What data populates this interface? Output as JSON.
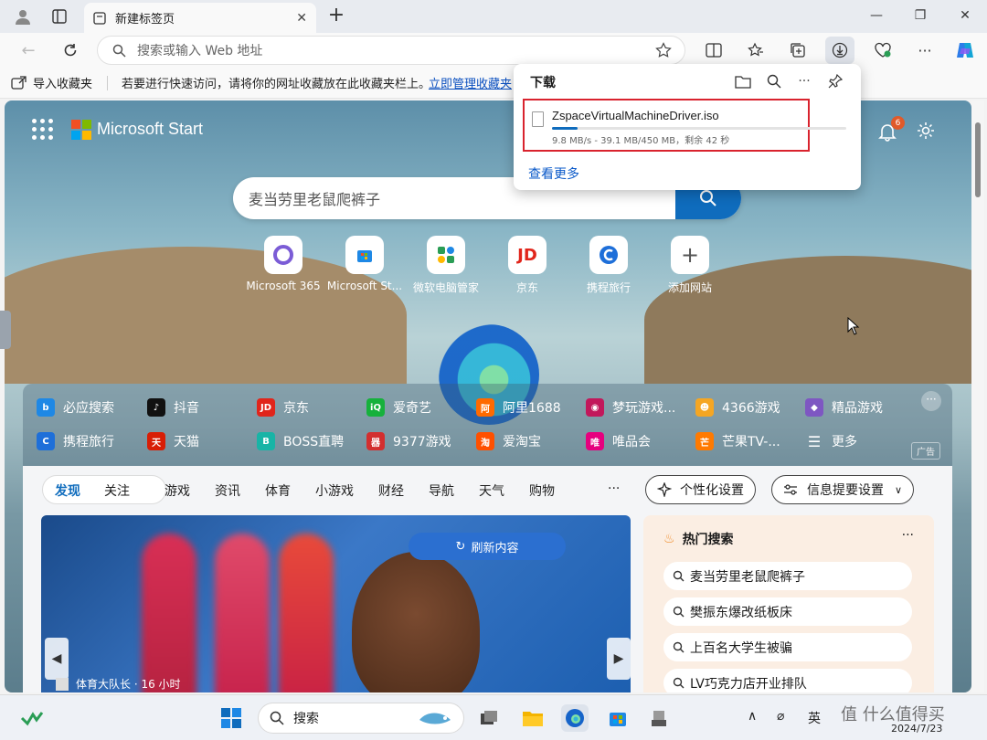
{
  "tab": {
    "title": "新建标签页",
    "close": "✕",
    "new_tab": "+"
  },
  "window": {
    "minimize": "—",
    "maximize": "❐",
    "close": "✕"
  },
  "address": {
    "placeholder": "搜索或输入 Web 地址"
  },
  "favorites_bar": {
    "import_label": "导入收藏夹",
    "message": "若要进行快速访问，请将你的网址收藏放在此收藏夹栏上。",
    "manage_link": "立即管理收藏夹"
  },
  "start": {
    "brand": "Microsoft Start",
    "notification_count": "6",
    "search_query": "麦当劳里老鼠爬裤子",
    "quick_links": [
      {
        "label": "Microsoft 365",
        "color": "#7b5cd6"
      },
      {
        "label": "Microsoft St...",
        "color": "#1e88e5"
      },
      {
        "label": "微软电脑管家",
        "color": "#2a9d55"
      },
      {
        "label": "京东",
        "color": "#e1251b"
      },
      {
        "label": "携程旅行",
        "color": "#1e6fd9"
      },
      {
        "label": "添加网站",
        "color": "#666666"
      }
    ],
    "link_panel": [
      {
        "label": "必应搜索",
        "color": "#1e88e5",
        "glyph": "b"
      },
      {
        "label": "抖音",
        "color": "#111111",
        "glyph": "♪"
      },
      {
        "label": "京东",
        "color": "#e1251b",
        "glyph": "JD"
      },
      {
        "label": "爱奇艺",
        "color": "#16b13c",
        "glyph": "iQ"
      },
      {
        "label": "阿里1688",
        "color": "#ff6a00",
        "glyph": "阿"
      },
      {
        "label": "梦玩游戏...",
        "color": "#c2185b",
        "glyph": "◉"
      },
      {
        "label": "4366游戏",
        "color": "#f5a623",
        "glyph": "☻"
      },
      {
        "label": "精品游戏",
        "color": "#7e57c2",
        "glyph": "◆"
      },
      {
        "label": "携程旅行",
        "color": "#1e6fd9",
        "glyph": "C"
      },
      {
        "label": "天猫",
        "color": "#d81e06",
        "glyph": "天"
      },
      {
        "label": "BOSS直聘",
        "color": "#18b4a6",
        "glyph": "B"
      },
      {
        "label": "9377游戏",
        "color": "#d32f2f",
        "glyph": "器"
      },
      {
        "label": "爱淘宝",
        "color": "#ff5000",
        "glyph": "淘"
      },
      {
        "label": "唯品会",
        "color": "#e6007e",
        "glyph": "唯"
      },
      {
        "label": "芒果TV-...",
        "color": "#ff7a00",
        "glyph": "芒"
      },
      {
        "label": "更多",
        "color": "transparent",
        "glyph": "☰"
      }
    ],
    "more_dots": "···",
    "ad_label": "广告"
  },
  "feed": {
    "tab_discover": "发现",
    "tab_follow": "关注",
    "categories": [
      "游戏",
      "资讯",
      "体育",
      "小游戏",
      "财经",
      "导航",
      "天气",
      "购物"
    ],
    "cat_more": "···",
    "personalize": "个性化设置",
    "info_settings": "信息提要设置",
    "refresh": "刷新内容",
    "hero_caption": "体育大队长 · 16 小时",
    "hot_title": "热门搜索",
    "hot_dots": "···",
    "hot_items": [
      "麦当劳里老鼠爬裤子",
      "樊振东爆改纸板床",
      "上百名大学生被骗",
      "LV巧克力店开业排队"
    ]
  },
  "downloads": {
    "title": "下载",
    "file_name": "ZspaceVirtualMachineDriver.iso",
    "status": "9.8 MB/s - 39.1 MB/450 MB，剩余 42 秒",
    "progress": 0.087,
    "see_more": "查看更多"
  },
  "taskbar": {
    "search_label": "搜索",
    "ime": "英",
    "date": "2024/7/23"
  },
  "watermark": "值 什么值得买",
  "colors": {
    "accent": "#0f6cbd",
    "highlight": "#d9232e"
  }
}
